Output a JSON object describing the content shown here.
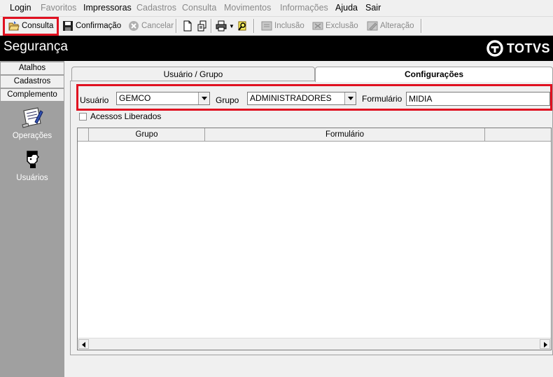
{
  "menu": {
    "login": "Login",
    "favoritos": "Favoritos",
    "impressoras": "Impressoras",
    "cadastros": "Cadastros",
    "consulta": "Consulta",
    "movimentos": "Movimentos",
    "informacoes": "Informações",
    "ajuda": "Ajuda",
    "sair": "Sair"
  },
  "toolbar": {
    "consulta": "Consulta",
    "confirmacao": "Confirmação",
    "cancelar": "Cancelar",
    "inclusao": "Inclusão",
    "exclusao": "Exclusão",
    "alteracao": "Alteração"
  },
  "header": {
    "title": "Segurança",
    "logo_text": "TOTVS"
  },
  "sidebar": {
    "tabs": [
      "Atalhos",
      "Cadastros",
      "Complemento"
    ],
    "items": [
      "Operações",
      "Usuários"
    ]
  },
  "main": {
    "tabs": [
      "Usuário  / Grupo",
      "Configurações"
    ],
    "active_tab": "Configurações"
  },
  "filters": {
    "usuario_label": "Usuário",
    "usuario_value": "GEMCO",
    "grupo_label": "Grupo",
    "grupo_value": "ADMINISTRADORES",
    "formulario_label": "Formulário",
    "formulario_value": "MIDIA"
  },
  "checkbox": {
    "label": "Acessos Liberados",
    "checked": false
  },
  "grid": {
    "columns": [
      "Grupo",
      "Formulário"
    ],
    "rows": []
  },
  "colors": {
    "highlight": "#e01020",
    "header_bg": "#000000",
    "sidebar_bg": "#a0a0a0",
    "disabled_text": "#8a8a8a"
  }
}
